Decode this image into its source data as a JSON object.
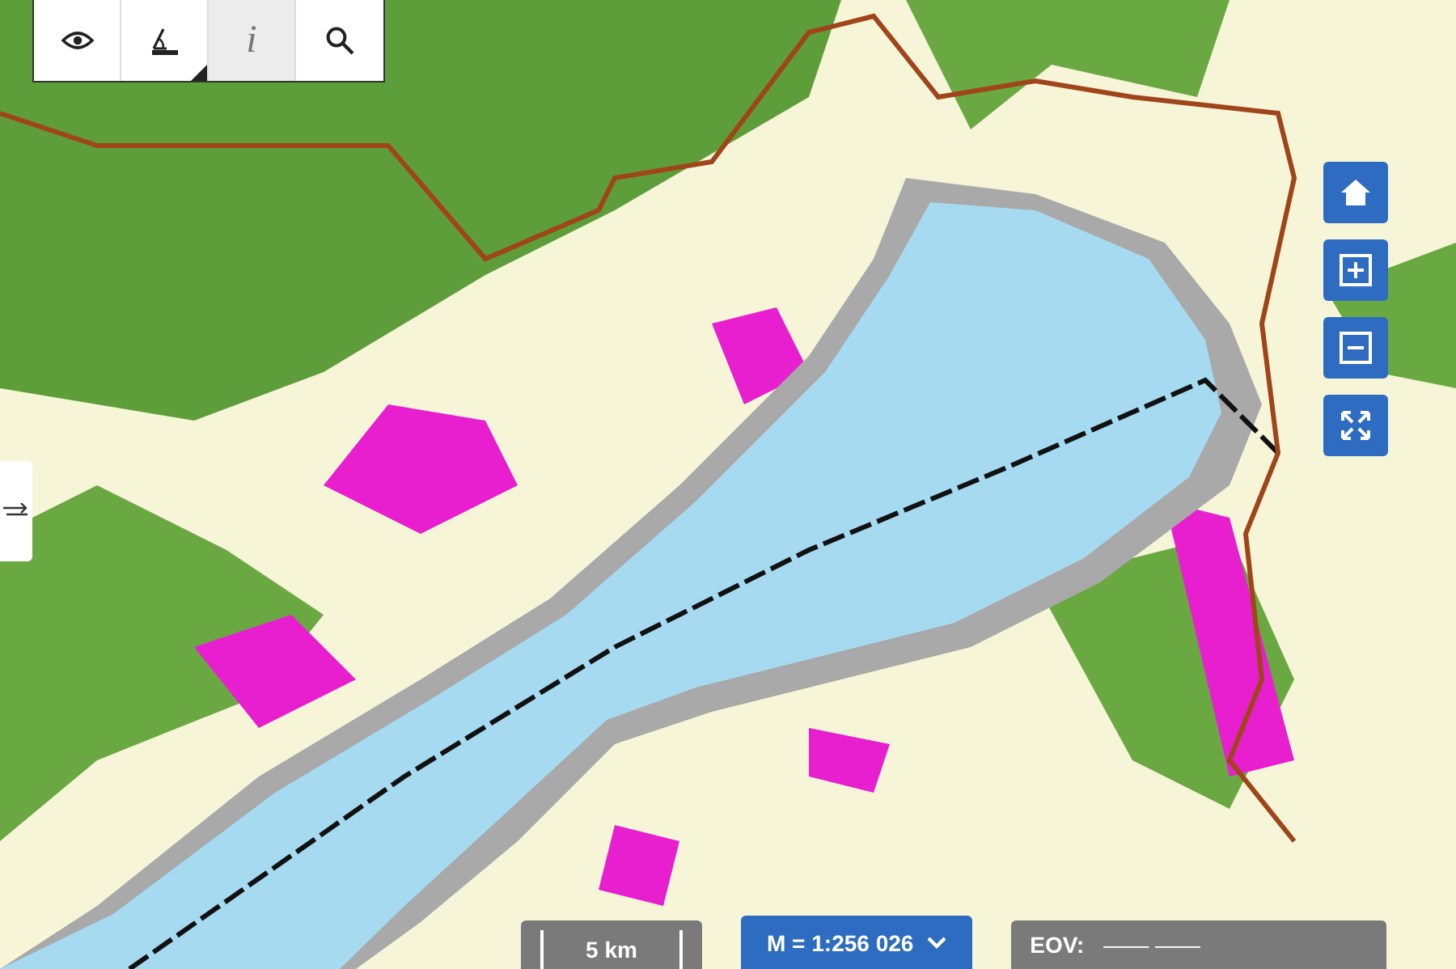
{
  "toolbar": {
    "tools": [
      {
        "kind": "view",
        "selected": false,
        "submenu": false
      },
      {
        "kind": "measure",
        "selected": false,
        "submenu": true
      },
      {
        "kind": "info",
        "label": "i",
        "selected": true,
        "submenu": false
      },
      {
        "kind": "search",
        "selected": false,
        "submenu": false
      }
    ]
  },
  "side_toggle": {
    "kind": "swap"
  },
  "map_controls": [
    {
      "kind": "home"
    },
    {
      "kind": "zoom-in"
    },
    {
      "kind": "zoom-out"
    },
    {
      "kind": "fullscreen"
    }
  ],
  "status_bar": {
    "scale_bar": "5 km",
    "scale": "M = 1:256 026",
    "coords_label": "EOV:",
    "coords_value": "—— ——"
  }
}
